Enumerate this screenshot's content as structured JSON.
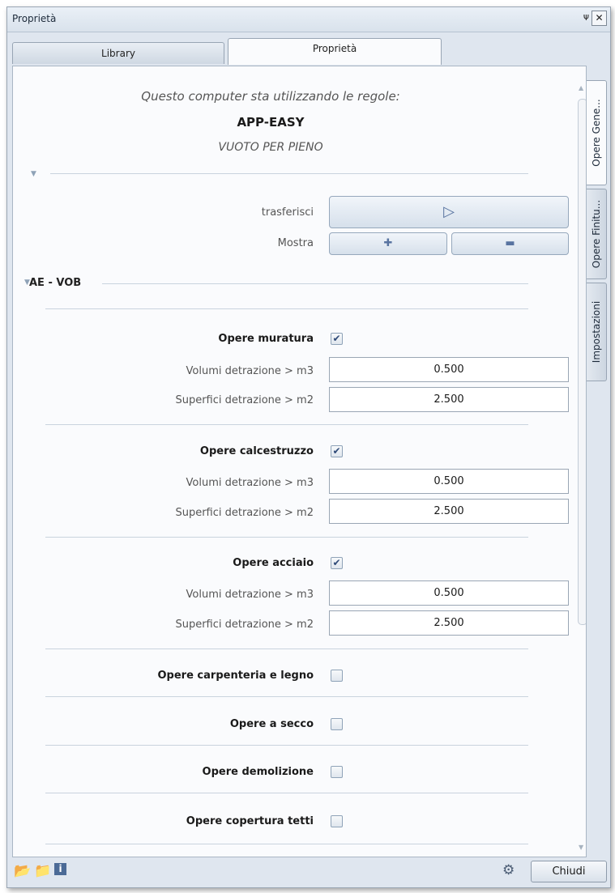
{
  "window": {
    "title": "Proprietà",
    "pin": "ᵖ",
    "close": "✕"
  },
  "tabs": {
    "library": "Library",
    "properties": "Proprietà"
  },
  "side_tabs": [
    "Opere Gene...",
    "Opere Finitu...",
    "Impostazioni"
  ],
  "info": {
    "rules_text": "Questo computer sta utilizzando le regole:",
    "rule_name": "APP-EASY",
    "mode": "VUOTO PER PIENO"
  },
  "transfer": {
    "label": "trasferisci",
    "icon": "play-icon"
  },
  "show": {
    "label": "Mostra",
    "plus_icon": "plus-icon",
    "minus_icon": "minus-icon"
  },
  "section": {
    "title": "AE - VOB"
  },
  "groups": [
    {
      "name": "Opere muratura",
      "checked": true,
      "volume_label": "Volumi detrazione > m3",
      "volume_value": "0.500",
      "surface_label": "Superfici detrazione > m2",
      "surface_value": "2.500"
    },
    {
      "name": "Opere calcestruzzo",
      "checked": true,
      "volume_label": "Volumi detrazione > m3",
      "volume_value": "0.500",
      "surface_label": "Superfici detrazione > m2",
      "surface_value": "2.500"
    },
    {
      "name": "Opere acciaio",
      "checked": true,
      "volume_label": "Volumi detrazione > m3",
      "volume_value": "0.500",
      "surface_label": "Superfici detrazione > m2",
      "surface_value": "2.500"
    }
  ],
  "unchecked": [
    {
      "name": "Opere carpenteria e legno",
      "checked": false
    },
    {
      "name": "Opere a secco",
      "checked": false
    },
    {
      "name": "Opere demolizione",
      "checked": false
    },
    {
      "name": "Opere copertura tetti",
      "checked": false
    }
  ],
  "footer": {
    "close_label": "Chiudi"
  },
  "check_glyph": "✔"
}
